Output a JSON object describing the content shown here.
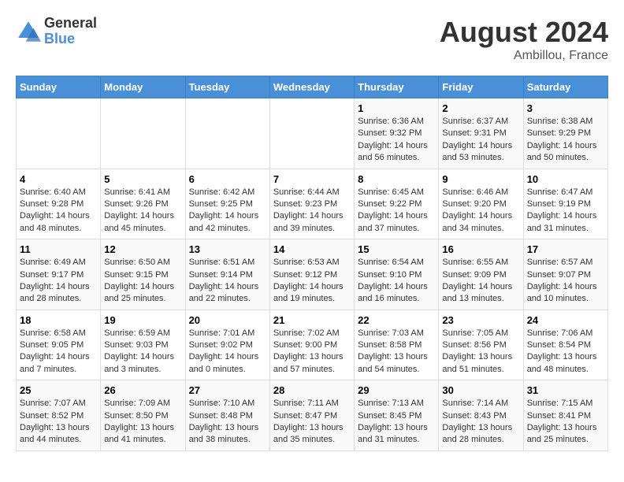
{
  "header": {
    "logo_general": "General",
    "logo_blue": "Blue",
    "main_title": "August 2024",
    "subtitle": "Ambillou, France"
  },
  "days_of_week": [
    "Sunday",
    "Monday",
    "Tuesday",
    "Wednesday",
    "Thursday",
    "Friday",
    "Saturday"
  ],
  "weeks": [
    [
      {
        "day": "",
        "info": ""
      },
      {
        "day": "",
        "info": ""
      },
      {
        "day": "",
        "info": ""
      },
      {
        "day": "",
        "info": ""
      },
      {
        "day": "1",
        "info": "Sunrise: 6:36 AM\nSunset: 9:32 PM\nDaylight: 14 hours and 56 minutes."
      },
      {
        "day": "2",
        "info": "Sunrise: 6:37 AM\nSunset: 9:31 PM\nDaylight: 14 hours and 53 minutes."
      },
      {
        "day": "3",
        "info": "Sunrise: 6:38 AM\nSunset: 9:29 PM\nDaylight: 14 hours and 50 minutes."
      }
    ],
    [
      {
        "day": "4",
        "info": "Sunrise: 6:40 AM\nSunset: 9:28 PM\nDaylight: 14 hours and 48 minutes."
      },
      {
        "day": "5",
        "info": "Sunrise: 6:41 AM\nSunset: 9:26 PM\nDaylight: 14 hours and 45 minutes."
      },
      {
        "day": "6",
        "info": "Sunrise: 6:42 AM\nSunset: 9:25 PM\nDaylight: 14 hours and 42 minutes."
      },
      {
        "day": "7",
        "info": "Sunrise: 6:44 AM\nSunset: 9:23 PM\nDaylight: 14 hours and 39 minutes."
      },
      {
        "day": "8",
        "info": "Sunrise: 6:45 AM\nSunset: 9:22 PM\nDaylight: 14 hours and 37 minutes."
      },
      {
        "day": "9",
        "info": "Sunrise: 6:46 AM\nSunset: 9:20 PM\nDaylight: 14 hours and 34 minutes."
      },
      {
        "day": "10",
        "info": "Sunrise: 6:47 AM\nSunset: 9:19 PM\nDaylight: 14 hours and 31 minutes."
      }
    ],
    [
      {
        "day": "11",
        "info": "Sunrise: 6:49 AM\nSunset: 9:17 PM\nDaylight: 14 hours and 28 minutes."
      },
      {
        "day": "12",
        "info": "Sunrise: 6:50 AM\nSunset: 9:15 PM\nDaylight: 14 hours and 25 minutes."
      },
      {
        "day": "13",
        "info": "Sunrise: 6:51 AM\nSunset: 9:14 PM\nDaylight: 14 hours and 22 minutes."
      },
      {
        "day": "14",
        "info": "Sunrise: 6:53 AM\nSunset: 9:12 PM\nDaylight: 14 hours and 19 minutes."
      },
      {
        "day": "15",
        "info": "Sunrise: 6:54 AM\nSunset: 9:10 PM\nDaylight: 14 hours and 16 minutes."
      },
      {
        "day": "16",
        "info": "Sunrise: 6:55 AM\nSunset: 9:09 PM\nDaylight: 14 hours and 13 minutes."
      },
      {
        "day": "17",
        "info": "Sunrise: 6:57 AM\nSunset: 9:07 PM\nDaylight: 14 hours and 10 minutes."
      }
    ],
    [
      {
        "day": "18",
        "info": "Sunrise: 6:58 AM\nSunset: 9:05 PM\nDaylight: 14 hours and 7 minutes."
      },
      {
        "day": "19",
        "info": "Sunrise: 6:59 AM\nSunset: 9:03 PM\nDaylight: 14 hours and 3 minutes."
      },
      {
        "day": "20",
        "info": "Sunrise: 7:01 AM\nSunset: 9:02 PM\nDaylight: 14 hours and 0 minutes."
      },
      {
        "day": "21",
        "info": "Sunrise: 7:02 AM\nSunset: 9:00 PM\nDaylight: 13 hours and 57 minutes."
      },
      {
        "day": "22",
        "info": "Sunrise: 7:03 AM\nSunset: 8:58 PM\nDaylight: 13 hours and 54 minutes."
      },
      {
        "day": "23",
        "info": "Sunrise: 7:05 AM\nSunset: 8:56 PM\nDaylight: 13 hours and 51 minutes."
      },
      {
        "day": "24",
        "info": "Sunrise: 7:06 AM\nSunset: 8:54 PM\nDaylight: 13 hours and 48 minutes."
      }
    ],
    [
      {
        "day": "25",
        "info": "Sunrise: 7:07 AM\nSunset: 8:52 PM\nDaylight: 13 hours and 44 minutes."
      },
      {
        "day": "26",
        "info": "Sunrise: 7:09 AM\nSunset: 8:50 PM\nDaylight: 13 hours and 41 minutes."
      },
      {
        "day": "27",
        "info": "Sunrise: 7:10 AM\nSunset: 8:48 PM\nDaylight: 13 hours and 38 minutes."
      },
      {
        "day": "28",
        "info": "Sunrise: 7:11 AM\nSunset: 8:47 PM\nDaylight: 13 hours and 35 minutes."
      },
      {
        "day": "29",
        "info": "Sunrise: 7:13 AM\nSunset: 8:45 PM\nDaylight: 13 hours and 31 minutes."
      },
      {
        "day": "30",
        "info": "Sunrise: 7:14 AM\nSunset: 8:43 PM\nDaylight: 13 hours and 28 minutes."
      },
      {
        "day": "31",
        "info": "Sunrise: 7:15 AM\nSunset: 8:41 PM\nDaylight: 13 hours and 25 minutes."
      }
    ]
  ]
}
